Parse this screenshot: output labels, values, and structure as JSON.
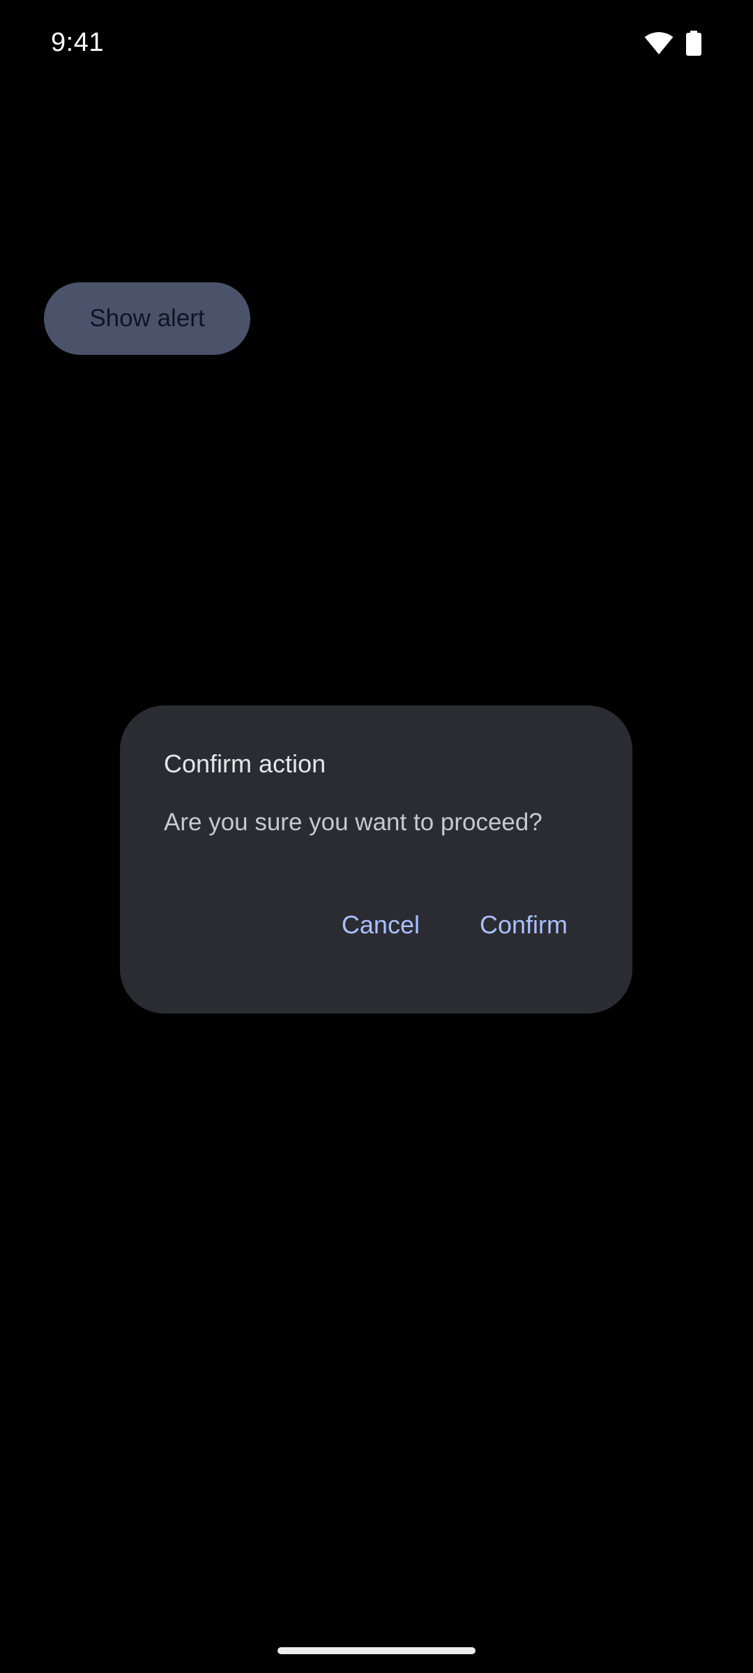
{
  "status_bar": {
    "time": "9:41",
    "icons": [
      "wifi-icon",
      "battery-icon"
    ]
  },
  "main": {
    "show_alert_label": "Show alert"
  },
  "dialog": {
    "title": "Confirm action",
    "message": "Are you sure you want to proceed?",
    "cancel_label": "Cancel",
    "confirm_label": "Confirm"
  },
  "colors": {
    "background": "#000000",
    "dialog_surface": "#2b2c32",
    "button_tonal": "#4a5369",
    "accent_text": "#a9c0ff"
  }
}
